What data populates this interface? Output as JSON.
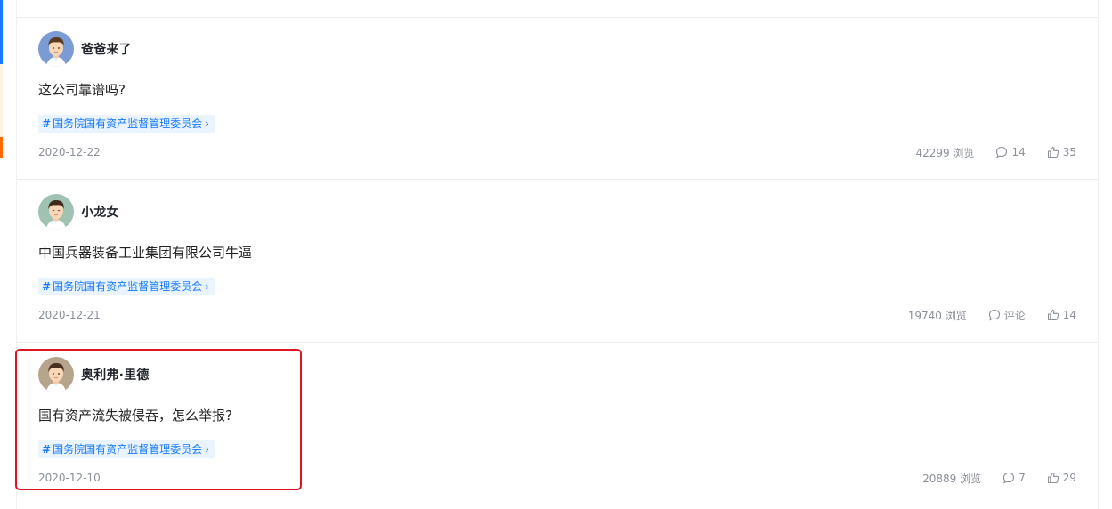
{
  "posts": [
    {
      "username": "爸爸来了",
      "avatar": "avatar-man-blue",
      "content": "这公司靠谱吗?",
      "tag": "国务院国有资产监督管理委员会",
      "date": "2020-12-22",
      "views": "42299 浏览",
      "comments": "14",
      "likes": "35"
    },
    {
      "username": "小龙女",
      "avatar": "avatar-man-green",
      "content": "中国兵器装备工业集团有限公司牛逼",
      "tag": "国务院国有资产监督管理委员会",
      "date": "2020-12-21",
      "views": "19740 浏览",
      "comments": "评论",
      "likes": "14"
    },
    {
      "username": "奥利弗·里德",
      "avatar": "avatar-man-tan",
      "content": "国有资产流失被侵吞，怎么举报?",
      "tag": "国务院国有资产监督管理委员会",
      "date": "2020-12-10",
      "views": "20889 浏览",
      "comments": "7",
      "likes": "29"
    }
  ],
  "colors": {
    "tag_text": "#1677ff",
    "tag_bg": "#eaf4ff",
    "highlight_border": "#e0141e",
    "meta_text": "#8a8f99"
  }
}
